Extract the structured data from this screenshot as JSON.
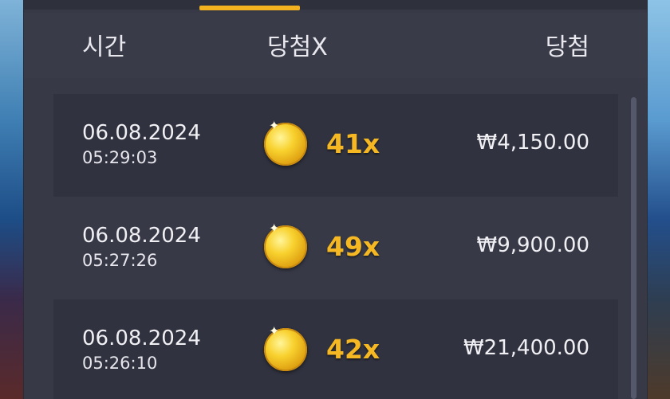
{
  "header": {
    "col_time": "시간",
    "col_multiplier": "당첨X",
    "col_win": "당첨"
  },
  "rows": [
    {
      "date": "06.08.2024",
      "time": "05:29:03",
      "multiplier": "41x",
      "amount": "₩4,150.00"
    },
    {
      "date": "06.08.2024",
      "time": "05:27:26",
      "multiplier": "49x",
      "amount": "₩9,900.00"
    },
    {
      "date": "06.08.2024",
      "time": "05:26:10",
      "multiplier": "42x",
      "amount": "₩21,400.00"
    }
  ],
  "colors": {
    "accent": "#f2b21f",
    "panel": "#373947",
    "row_alt": "#30323f",
    "multiplier_text": "#f5b822"
  },
  "icons": {
    "row_icon": "gold-coin-icon"
  }
}
